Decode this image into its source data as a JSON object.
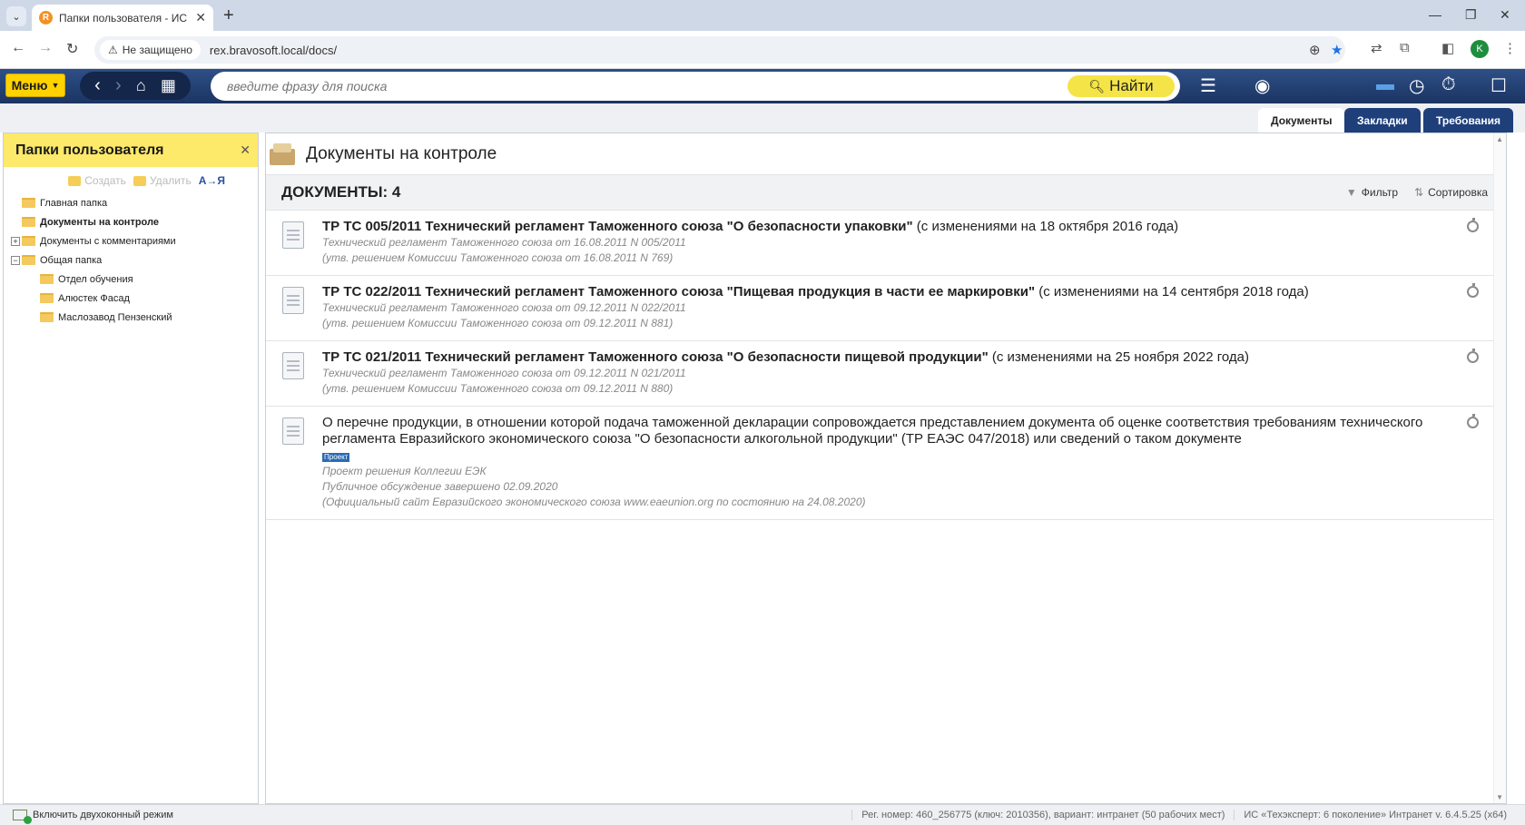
{
  "browser": {
    "tab_title": "Папки пользователя - ИС «Те",
    "favicon": "R",
    "security_label": "Не защищено",
    "url": "rex.bravosoft.local/docs/",
    "profile_initial": "K"
  },
  "app": {
    "menu_label": "Меню",
    "search_placeholder": "введите фразу для поиска",
    "find_label": "Найти",
    "tabs": [
      {
        "label": "Документы"
      },
      {
        "label": "Закладки"
      },
      {
        "label": "Требования"
      }
    ]
  },
  "folders": {
    "title": "Папки пользователя",
    "actions": {
      "create": "Создать",
      "delete": "Удалить",
      "sort": "А→Я"
    },
    "items": [
      {
        "label": "Главная папка",
        "level": 0,
        "expander": ""
      },
      {
        "label": "Документы на контроле",
        "level": 0,
        "expander": "",
        "selected": true
      },
      {
        "label": "Документы с комментариями",
        "level": 0,
        "expander": "+"
      },
      {
        "label": "Общая папка",
        "level": 0,
        "expander": "−"
      },
      {
        "label": "Отдел обучения",
        "level": 1,
        "expander": ""
      },
      {
        "label": "Алюстек Фасад",
        "level": 1,
        "expander": ""
      },
      {
        "label": "Маслозавод Пензенский",
        "level": 1,
        "expander": ""
      }
    ]
  },
  "main": {
    "title": "Документы на контроле",
    "count_label": "ДОКУМЕНТЫ: 4",
    "filter_label": "Фильтр",
    "sort_label": "Сортировка",
    "documents": [
      {
        "title_bold": "ТР ТС 005/2011 Технический регламент Таможенного союза \"О безопасности упаковки\"",
        "title_rest": " (с изменениями на 18 октября 2016 года)",
        "line1": "Технический регламент Таможенного союза от 16.08.2011 N 005/2011",
        "line2": "(утв. решением Комиссии Таможенного союза от 16.08.2011 N 769)"
      },
      {
        "title_bold": "ТР ТС 022/2011 Технический регламент Таможенного союза \"Пищевая продукция в части ее маркировки\"",
        "title_rest": " (с изменениями на 14 сентября 2018 года)",
        "line1": "Технический регламент Таможенного союза от 09.12.2011 N 022/2011",
        "line2": "(утв. решением Комиссии Таможенного союза от 09.12.2011 N 881)"
      },
      {
        "title_bold": "ТР ТС 021/2011 Технический регламент Таможенного союза \"О безопасности пищевой продукции\"",
        "title_rest": " (с изменениями на 25 ноября 2022 года)",
        "line1": "Технический регламент Таможенного союза от 09.12.2011 N 021/2011",
        "line2": "(утв. решением Комиссии Таможенного союза от 09.12.2011 N 880)"
      },
      {
        "title_plain": "О перечне продукции, в отношении которой подача таможенной декларации сопровождается представлением документа об оценке соответствия требованиям технического регламента Евразийского экономического союза \"О безопасности алкогольной продукции\" (ТР ЕАЭС 047/2018) или сведений о таком документе",
        "badge": "Проект",
        "line1": "Проект решения Коллегии ЕЭК",
        "line2": "Публичное обсуждение завершено 02.09.2020",
        "line3": "(Официальный сайт Евразийского экономического союза www.eaeunion.org по состоянию на 24.08.2020)"
      }
    ]
  },
  "status": {
    "dual_mode": "Включить двухоконный режим",
    "reg_info": "Рег. номер: 460_256775 (ключ: 2010356), вариант: интранет (50 рабочих мест)",
    "product_info": "ИС «Техэксперт: 6 поколение» Интранет v. 6.4.5.25 (x64)"
  }
}
